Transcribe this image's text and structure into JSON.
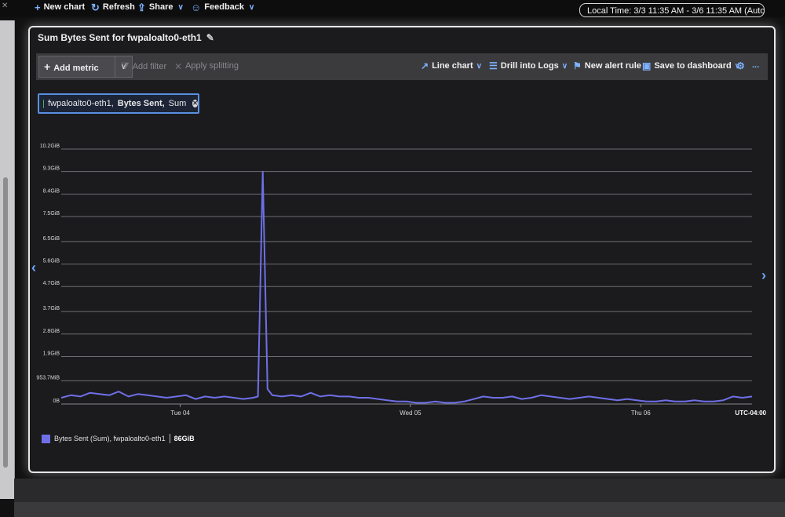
{
  "toolbar_top": {
    "new_chart": "New chart",
    "refresh": "Refresh",
    "share": "Share",
    "feedback": "Feedback",
    "time_range": "Local Time: 3/3 11:35 AM - 3/6 11:35 AM (Auto..."
  },
  "card": {
    "title": "Sum Bytes Sent for fwpaloalto0-eth1"
  },
  "chart_toolbar": {
    "add_metric": "Add metric",
    "add_filter": "Add filter",
    "apply_splitting": "Apply splitting",
    "line_chart": "Line chart",
    "drill_logs": "Drill into Logs",
    "new_alert": "New alert rule",
    "save_dashboard": "Save to dashboard",
    "more": "..."
  },
  "metric_pill": {
    "resource": "fwpaloalto0-eth1,",
    "metric": "Bytes Sent,",
    "aggregation": "Sum"
  },
  "colors": {
    "series": "#6f6fe8",
    "accent": "#7fb2ff"
  },
  "legend": {
    "label": "Bytes Sent (Sum), fwpaloalto0-eth1",
    "value": "86GiB"
  },
  "chart_data": {
    "type": "line",
    "timezone": "UTC-04:00",
    "x_tick_labels": [
      "Tue 04",
      "Wed 05",
      "Thu 06"
    ],
    "y_tick_labels": [
      "10.2GiB",
      "9.3GiB",
      "8.4GiB",
      "7.5GiB",
      "6.5GiB",
      "5.6GiB",
      "4.7GiB",
      "3.7GiB",
      "2.8GiB",
      "1.9GiB",
      "953.7MiB",
      "0B"
    ],
    "y_values_gib": [
      10.2,
      9.3,
      8.4,
      7.5,
      6.5,
      5.6,
      4.7,
      3.7,
      2.8,
      1.9,
      0.93,
      0
    ],
    "ylim": [
      0,
      10.2
    ],
    "xlim_hours": [
      0,
      72
    ],
    "x_tick_hours": [
      12.4,
      36.4,
      60.4
    ],
    "series": [
      {
        "name": "Bytes Sent (Sum), fwpaloalto0-eth1",
        "x_hours": [
          0,
          1,
          2,
          3,
          4,
          5,
          6,
          7,
          8,
          9,
          10,
          11,
          12,
          13,
          14,
          15,
          16,
          17,
          18,
          19,
          20,
          20.5,
          21,
          21.5,
          22,
          23,
          24,
          25,
          26,
          27,
          28,
          29,
          30,
          31,
          32,
          33,
          34,
          35,
          36,
          37,
          38,
          39,
          40,
          41,
          42,
          43,
          44,
          45,
          46,
          47,
          48,
          49,
          50,
          51,
          52,
          53,
          54,
          55,
          56,
          57,
          58,
          59,
          60,
          61,
          62,
          63,
          64,
          65,
          66,
          67,
          68,
          69,
          70,
          71,
          72
        ],
        "y_gib": [
          0.25,
          0.35,
          0.3,
          0.45,
          0.4,
          0.35,
          0.5,
          0.3,
          0.4,
          0.35,
          0.3,
          0.25,
          0.3,
          0.35,
          0.2,
          0.3,
          0.25,
          0.3,
          0.25,
          0.2,
          0.25,
          0.3,
          9.3,
          0.6,
          0.35,
          0.3,
          0.35,
          0.3,
          0.45,
          0.3,
          0.35,
          0.3,
          0.3,
          0.25,
          0.25,
          0.2,
          0.15,
          0.1,
          0.1,
          0.05,
          0.05,
          0.1,
          0.05,
          0.05,
          0.1,
          0.2,
          0.3,
          0.25,
          0.25,
          0.3,
          0.2,
          0.25,
          0.35,
          0.3,
          0.25,
          0.2,
          0.25,
          0.3,
          0.25,
          0.2,
          0.15,
          0.2,
          0.15,
          0.1,
          0.1,
          0.15,
          0.1,
          0.1,
          0.15,
          0.1,
          0.1,
          0.15,
          0.3,
          0.25,
          0.3
        ]
      }
    ]
  }
}
